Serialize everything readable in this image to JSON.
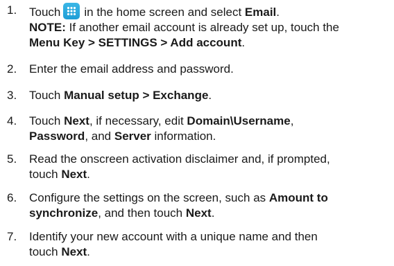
{
  "steps": [
    {
      "number": "1.",
      "lines": [
        {
          "a": "Touch",
          "b": "in the home screen and select",
          "c": "Email",
          "d": "."
        },
        {
          "a": "NOTE:",
          "b": " If another email account is already set up, touch the"
        },
        {
          "a": "Menu Key > SETTINGS > Add account",
          "b": "."
        }
      ]
    },
    {
      "number": "2.",
      "text": "Enter the email address and password."
    },
    {
      "number": "3.",
      "a": "Touch ",
      "b": "Manual setup > Exchange",
      "c": "."
    },
    {
      "number": "4.",
      "l1": {
        "a": "Touch ",
        "b": "Next",
        "c": ", if necessary, edit ",
        "d": "Domain\\Username",
        "e": ","
      },
      "l2": {
        "a": "Password",
        "b": ", and ",
        "c": "Server",
        "d": " information."
      }
    },
    {
      "number": "5.",
      "l1": "Read the onscreen activation disclaimer and, if prompted,",
      "l2": {
        "a": "touch ",
        "b": "Next",
        "c": "."
      }
    },
    {
      "number": "6.",
      "l1": {
        "a": "Configure the settings on the screen, such as ",
        "b": "Amount to"
      },
      "l2": {
        "a": "synchronize",
        "b": ", and then touch ",
        "c": "Next",
        "d": "."
      }
    },
    {
      "number": "7.",
      "l1": "Identify your new account with a unique name and then",
      "l2": {
        "a": "touch ",
        "b": "Next",
        "c": "."
      }
    }
  ],
  "icon": "apps-grid-icon"
}
